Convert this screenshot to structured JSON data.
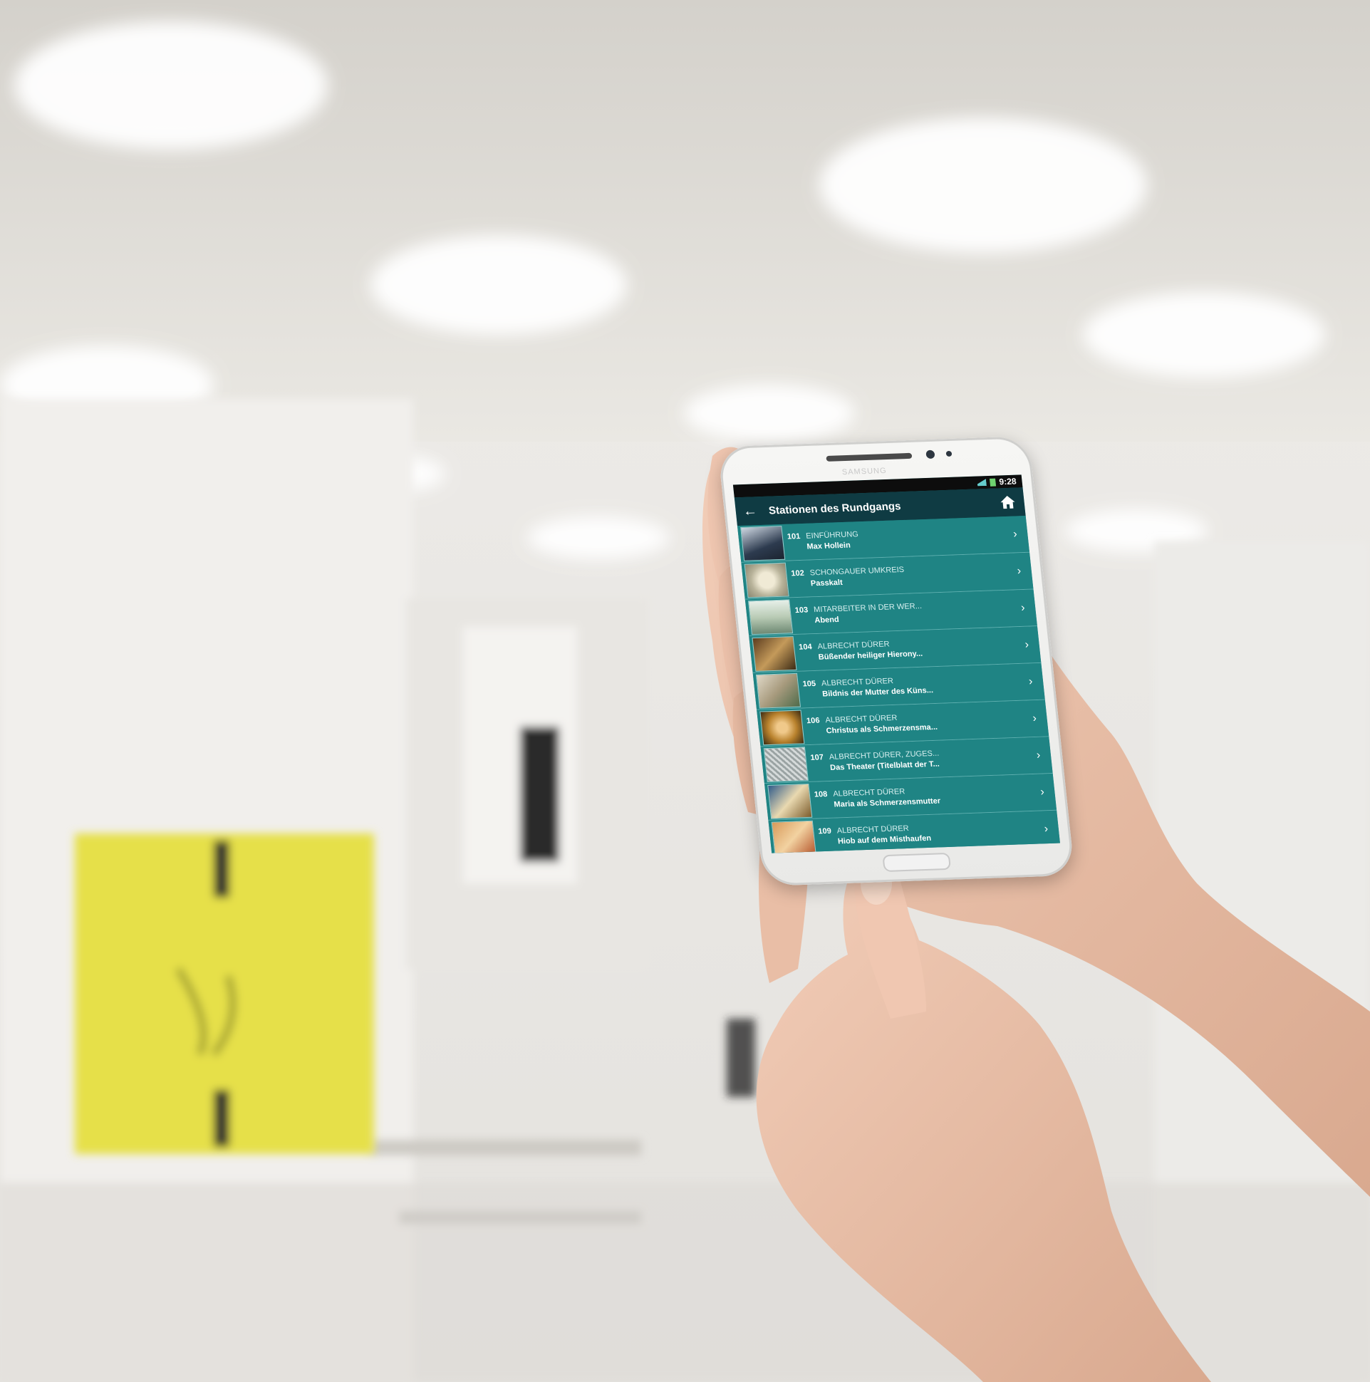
{
  "app": {
    "status_time": "9:28",
    "title": "Stationen des Rundgangs",
    "rows": [
      {
        "number": "101",
        "category": "EINFÜHRUNG",
        "subtitle": "Max Hollein"
      },
      {
        "number": "102",
        "category": "SCHONGAUER UMKREIS",
        "subtitle": "Passkalt"
      },
      {
        "number": "103",
        "category": "MITARBEITER IN DER WER...",
        "subtitle": "Abend"
      },
      {
        "number": "104",
        "category": "ALBRECHT DÜRER",
        "subtitle": "Büßender heiliger Hierony..."
      },
      {
        "number": "105",
        "category": "ALBRECHT DÜRER",
        "subtitle": "Bildnis der Mutter des Küns..."
      },
      {
        "number": "106",
        "category": "ALBRECHT DÜRER",
        "subtitle": "Christus als Schmerzensma..."
      },
      {
        "number": "107",
        "category": "ALBRECHT DÜRER, ZUGES...",
        "subtitle": "Das Theater (Titelblatt der T..."
      },
      {
        "number": "108",
        "category": "ALBRECHT DÜRER",
        "subtitle": "Maria als Schmerzensmutter"
      },
      {
        "number": "109",
        "category": "ALBRECHT DÜRER",
        "subtitle": "Hiob auf dem Misthaufen"
      }
    ]
  },
  "colors": {
    "screen_teal": "#1f8484",
    "appbar": "#0f3b43",
    "wall_yellow": "#e6e04a"
  },
  "icons": [
    "back-arrow-icon",
    "home-icon",
    "chevron-right-icon"
  ]
}
